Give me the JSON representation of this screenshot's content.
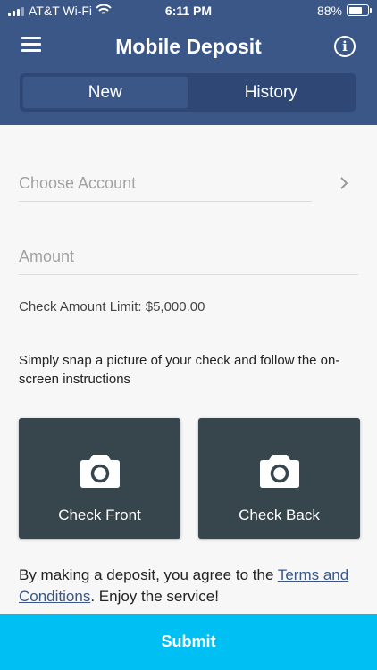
{
  "status_bar": {
    "carrier": "AT&T Wi-Fi",
    "time": "6:11 PM",
    "battery_percent": "88%",
    "battery_level": 0.88
  },
  "nav": {
    "title": "Mobile Deposit",
    "menu_icon": "hamburger-menu-icon",
    "info_icon": "info-icon",
    "info_glyph": "i"
  },
  "tabs": [
    {
      "label": "New",
      "active": true
    },
    {
      "label": "History",
      "active": false
    }
  ],
  "form": {
    "choose_account_placeholder": "Choose Account",
    "amount_placeholder": "Amount",
    "limit_text": "Check Amount Limit: $5,000.00",
    "instructions": "Simply snap a picture of your check and follow the on-screen instructions"
  },
  "capture": {
    "front_label": "Check Front",
    "back_label": "Check Back",
    "icon": "camera-icon"
  },
  "agreement": {
    "prefix": "By making a deposit, you agree to the ",
    "link": "Terms and Conditions",
    "suffix": ". Enjoy the service!"
  },
  "submit_label": "Submit",
  "colors": {
    "header": "#3a5788",
    "submit": "#00c0f3",
    "capture_tile": "#37454d"
  }
}
